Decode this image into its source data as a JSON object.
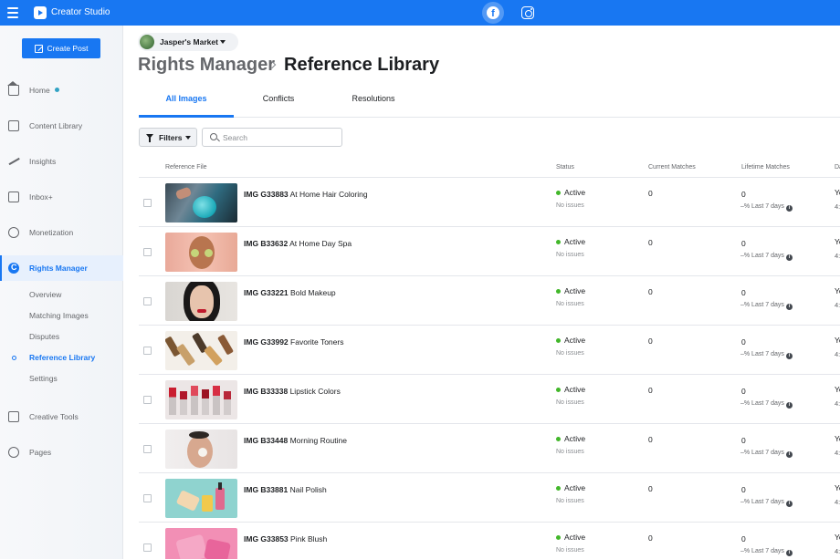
{
  "app": {
    "title": "Creator Studio",
    "platform_tabs": [
      "facebook-icon",
      "instagram-icon"
    ]
  },
  "sidebar": {
    "create_post": "Create Post",
    "items": [
      {
        "label": "Home",
        "icon": "home-icon"
      },
      {
        "label": "Content Library",
        "icon": "library-icon"
      },
      {
        "label": "Insights",
        "icon": "insights-icon"
      },
      {
        "label": "Inbox+",
        "icon": "inbox-icon"
      },
      {
        "label": "Monetization",
        "icon": "monetization-icon"
      },
      {
        "label": "Rights Manager",
        "icon": "rights-manager-icon"
      },
      {
        "label": "Creative Tools",
        "icon": "creative-tools-icon"
      },
      {
        "label": "Pages",
        "icon": "pages-icon"
      }
    ],
    "subitems": [
      "Overview",
      "Matching Images",
      "Disputes",
      "Reference Library",
      "Settings"
    ]
  },
  "page": {
    "name": "Jasper's Market",
    "breadcrumb_parent": "Rights Manager",
    "title": "Reference Library"
  },
  "tabs": [
    "All Images",
    "Conflicts",
    "Resolutions"
  ],
  "toolbar": {
    "filters": "Filters",
    "search_placeholder": "Search"
  },
  "table": {
    "columns": [
      "Reference File",
      "Status",
      "Current Matches",
      "Lifetime Matches",
      "Da"
    ],
    "rows": [
      {
        "id": "IMG G33883",
        "title": "At Home Hair Coloring",
        "status": "Active",
        "status_sub": "No issues",
        "current": "0",
        "lifetime": "0",
        "lifetime_sub": "–% Last 7 days",
        "date1": "Ye",
        "date2": "4:"
      },
      {
        "id": "IMG B33632",
        "title": "At Home Day Spa",
        "status": "Active",
        "status_sub": "No issues",
        "current": "0",
        "lifetime": "0",
        "lifetime_sub": "–% Last 7 days",
        "date1": "Ye",
        "date2": "4:"
      },
      {
        "id": "IMG G33221",
        "title": "Bold Makeup",
        "status": "Active",
        "status_sub": "No issues",
        "current": "0",
        "lifetime": "0",
        "lifetime_sub": "–% Last 7 days",
        "date1": "Ye",
        "date2": "4:"
      },
      {
        "id": "IMG G33992",
        "title": "Favorite Toners",
        "status": "Active",
        "status_sub": "No issues",
        "current": "0",
        "lifetime": "0",
        "lifetime_sub": "–% Last 7 days",
        "date1": "Ye",
        "date2": "4:"
      },
      {
        "id": "IMG B33338",
        "title": "Lipstick Colors",
        "status": "Active",
        "status_sub": "No issues",
        "current": "0",
        "lifetime": "0",
        "lifetime_sub": "–% Last 7 days",
        "date1": "Ye",
        "date2": "4:"
      },
      {
        "id": "IMG B33448",
        "title": "Morning Routine",
        "status": "Active",
        "status_sub": "No issues",
        "current": "0",
        "lifetime": "0",
        "lifetime_sub": "–% Last 7 days",
        "date1": "Ye",
        "date2": "4:"
      },
      {
        "id": "IMG B33881",
        "title": "Nail Polish",
        "status": "Active",
        "status_sub": "No issues",
        "current": "0",
        "lifetime": "0",
        "lifetime_sub": "–% Last 7 days",
        "date1": "Ye",
        "date2": "4:"
      },
      {
        "id": "IMG G33853",
        "title": "Pink Blush",
        "status": "Active",
        "status_sub": "No issues",
        "current": "0",
        "lifetime": "0",
        "lifetime_sub": "–% Last 7 days",
        "date1": "Ye",
        "date2": "4:"
      }
    ]
  },
  "colors": {
    "brand": "#1877f2",
    "status_active": "#42b72a",
    "notification_dot": "#31a2c4"
  }
}
